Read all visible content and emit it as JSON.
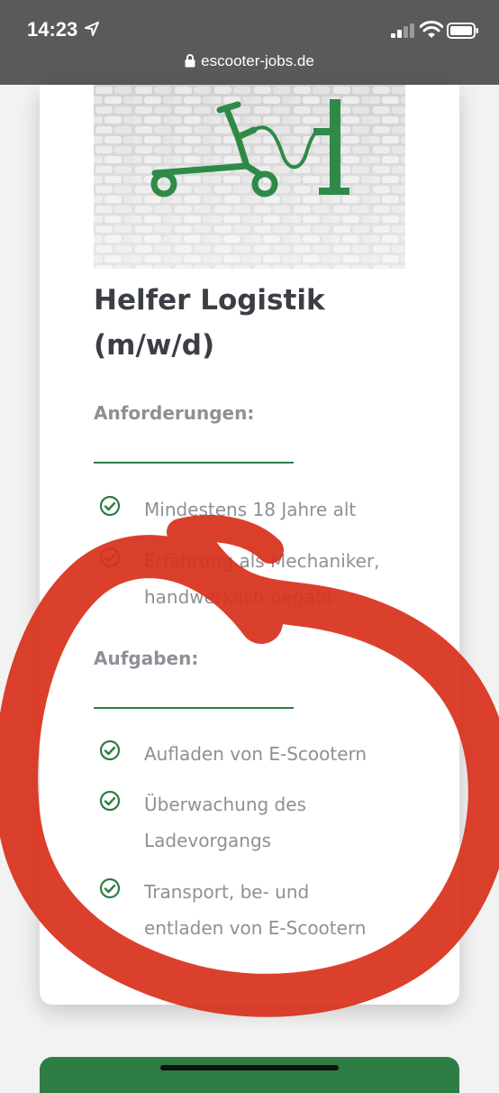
{
  "status_bar": {
    "time": "14:23",
    "url": "escooter-jobs.de",
    "icons": [
      "location-arrow-icon",
      "signal-icon",
      "wifi-icon",
      "battery-icon",
      "lock-icon"
    ]
  },
  "job": {
    "title_line1": "Helfer Logistik",
    "title_line2": "(m/w/d)",
    "hero_image": "scooter-charging-logo-on-cobblestone",
    "accent_color": "#2e7d45"
  },
  "requirements": {
    "heading": "Anforderungen:",
    "items": [
      {
        "lines": [
          "Mindestens 18 Jahre alt"
        ]
      },
      {
        "lines": [
          "Erfahrung als Mechaniker,",
          "handwerklich begabt"
        ]
      }
    ]
  },
  "tasks": {
    "heading": "Aufgaben:",
    "items": [
      {
        "lines": [
          "Aufladen von E-Scootern"
        ]
      },
      {
        "lines": [
          "Überwachung des",
          "Ladevorgangs"
        ]
      },
      {
        "lines": [
          "Transport, be- und",
          "entladen von E-Scootern"
        ]
      }
    ]
  },
  "annotation": {
    "type": "red-hand-drawn-circle",
    "color": "#d8311c"
  }
}
